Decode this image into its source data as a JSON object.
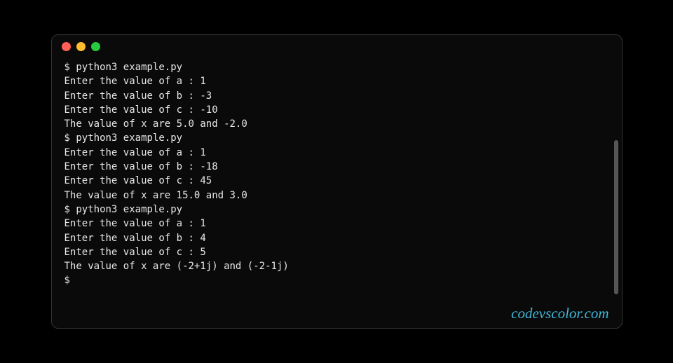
{
  "window": {
    "close_color": "#ff5f56",
    "minimize_color": "#ffbd2e",
    "maximize_color": "#27c93f"
  },
  "terminal": {
    "lines": [
      "$ python3 example.py",
      "Enter the value of a : 1",
      "Enter the value of b : -3",
      "Enter the value of c : -10",
      "The value of x are 5.0 and -2.0",
      "$ python3 example.py",
      "Enter the value of a : 1",
      "Enter the value of b : -18",
      "Enter the value of c : 45",
      "The value of x are 15.0 and 3.0",
      "$ python3 example.py",
      "Enter the value of a : 1",
      "Enter the value of b : 4",
      "Enter the value of c : 5",
      "The value of x are (-2+1j) and (-2-1j)",
      "$"
    ]
  },
  "watermark": "codevscolor.com"
}
